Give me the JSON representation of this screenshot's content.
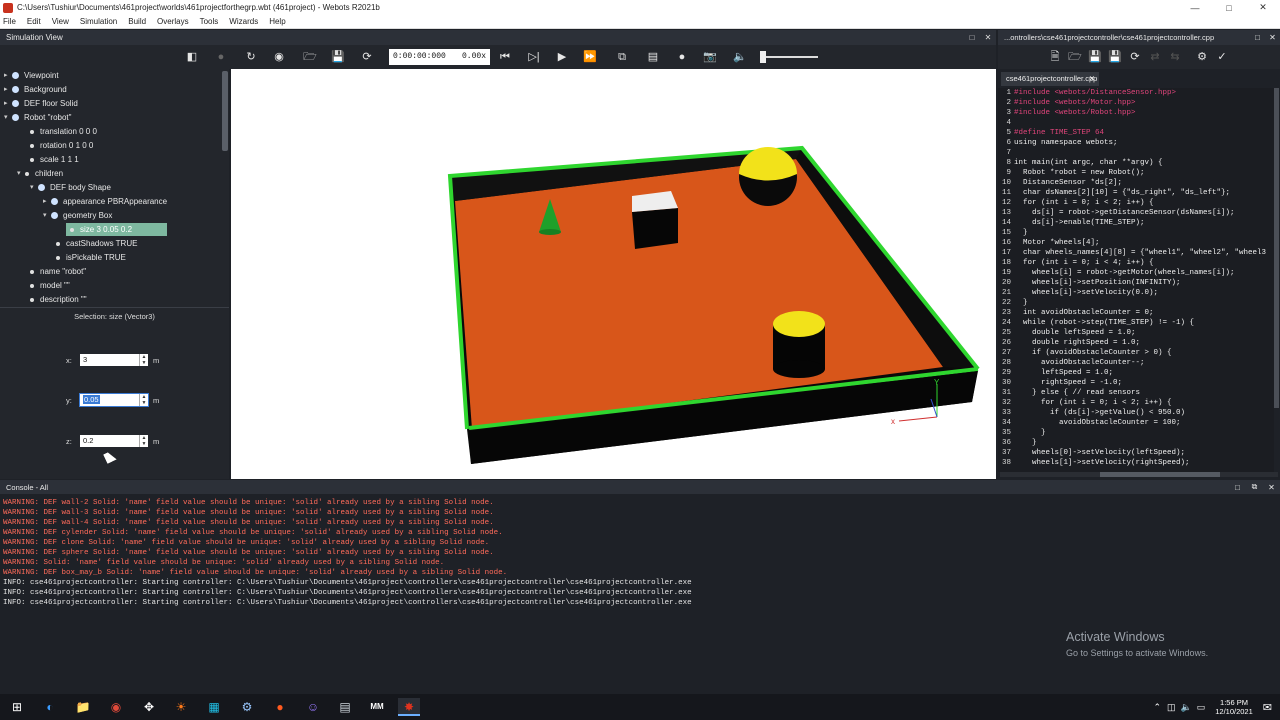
{
  "window": {
    "title": "C:\\Users\\Tushiur\\Documents\\461project\\worlds\\461projectforthegrp.wbt (461project) - Webots R2021b"
  },
  "menu": [
    "File",
    "Edit",
    "View",
    "Simulation",
    "Build",
    "Overlays",
    "Tools",
    "Wizards",
    "Help"
  ],
  "simulation_view": {
    "title": "Simulation View",
    "time": "0:00:00:000",
    "speed": "0.00x"
  },
  "scene_tree": {
    "items": [
      {
        "label": "Viewpoint"
      },
      {
        "label": "Background"
      },
      {
        "label": "DEF floor Solid"
      },
      {
        "label": "Robot \"robot\""
      },
      {
        "label": "translation 0 0 0"
      },
      {
        "label": "rotation 0 1 0 0"
      },
      {
        "label": "scale 1 1 1"
      },
      {
        "label": "children"
      },
      {
        "label": "DEF body Shape"
      },
      {
        "label": "appearance PBRAppearance"
      },
      {
        "label": "geometry Box"
      },
      {
        "label": "size 3 0.05 0.2"
      },
      {
        "label": "castShadows TRUE"
      },
      {
        "label": "isPickable TRUE"
      },
      {
        "label": "name \"robot\""
      },
      {
        "label": "model \"\""
      },
      {
        "label": "description \"\""
      }
    ]
  },
  "field_editor": {
    "selection": "Selection: size (Vector3)",
    "x": {
      "label": "x:",
      "value": "3",
      "unit": "m"
    },
    "y": {
      "label": "y:",
      "value": "0.05",
      "unit": "m"
    },
    "z": {
      "label": "z:",
      "value": "0.2",
      "unit": "m"
    }
  },
  "viewport": {
    "axis_x": "x",
    "axis_y": "Y"
  },
  "editor": {
    "header": "...ontrollers\\cse461projectcontroller\\cse461projectcontroller.cpp",
    "tab": "cse461projectcontroller.cpp",
    "lines": [
      {
        "n": "1",
        "t": "#include <webots/DistanceSensor.hpp>"
      },
      {
        "n": "2",
        "t": "#include <webots/Motor.hpp>"
      },
      {
        "n": "3",
        "t": "#include <webots/Robot.hpp>"
      },
      {
        "n": "4",
        "t": ""
      },
      {
        "n": "5",
        "t": "#define TIME_STEP 64"
      },
      {
        "n": "6",
        "t": "using namespace webots;"
      },
      {
        "n": "7",
        "t": ""
      },
      {
        "n": "8",
        "t": "int main(int argc, char **argv) {"
      },
      {
        "n": "9",
        "t": "  Robot *robot = new Robot();"
      },
      {
        "n": "10",
        "t": "  DistanceSensor *ds[2];"
      },
      {
        "n": "11",
        "t": "  char dsNames[2][10] = {\"ds_right\", \"ds_left\"};"
      },
      {
        "n": "12",
        "t": "  for (int i = 0; i < 2; i++) {"
      },
      {
        "n": "13",
        "t": "    ds[i] = robot->getDistanceSensor(dsNames[i]);"
      },
      {
        "n": "14",
        "t": "    ds[i]->enable(TIME_STEP);"
      },
      {
        "n": "15",
        "t": "  }"
      },
      {
        "n": "16",
        "t": "  Motor *wheels[4];"
      },
      {
        "n": "17",
        "t": "  char wheels_names[4][8] = {\"wheel1\", \"wheel2\", \"wheel3"
      },
      {
        "n": "18",
        "t": "  for (int i = 0; i < 4; i++) {"
      },
      {
        "n": "19",
        "t": "    wheels[i] = robot->getMotor(wheels_names[i]);"
      },
      {
        "n": "20",
        "t": "    wheels[i]->setPosition(INFINITY);"
      },
      {
        "n": "21",
        "t": "    wheels[i]->setVelocity(0.0);"
      },
      {
        "n": "22",
        "t": "  }"
      },
      {
        "n": "23",
        "t": "  int avoidObstacleCounter = 0;"
      },
      {
        "n": "24",
        "t": "  while (robot->step(TIME_STEP) != -1) {"
      },
      {
        "n": "25",
        "t": "    double leftSpeed = 1.0;"
      },
      {
        "n": "26",
        "t": "    double rightSpeed = 1.0;"
      },
      {
        "n": "27",
        "t": "    if (avoidObstacleCounter > 0) {"
      },
      {
        "n": "28",
        "t": "      avoidObstacleCounter--;"
      },
      {
        "n": "29",
        "t": "      leftSpeed = 1.0;"
      },
      {
        "n": "30",
        "t": "      rightSpeed = -1.0;"
      },
      {
        "n": "31",
        "t": "    } else { // read sensors"
      },
      {
        "n": "32",
        "t": "      for (int i = 0; i < 2; i++) {"
      },
      {
        "n": "33",
        "t": "        if (ds[i]->getValue() < 950.0)"
      },
      {
        "n": "34",
        "t": "          avoidObstacleCounter = 100;"
      },
      {
        "n": "35",
        "t": "      }"
      },
      {
        "n": "36",
        "t": "    }"
      },
      {
        "n": "37",
        "t": "    wheels[0]->setVelocity(leftSpeed);"
      },
      {
        "n": "38",
        "t": "    wheels[1]->setVelocity(rightSpeed);"
      }
    ]
  },
  "console": {
    "title": "Console - All",
    "messages": [
      {
        "level": "warn",
        "text": "WARNING: DEF wall-2 Solid: 'name' field value should be unique: 'solid' already used by a sibling Solid node."
      },
      {
        "level": "warn",
        "text": "WARNING: DEF wall-3 Solid: 'name' field value should be unique: 'solid' already used by a sibling Solid node."
      },
      {
        "level": "warn",
        "text": "WARNING: DEF wall-4 Solid: 'name' field value should be unique: 'solid' already used by a sibling Solid node."
      },
      {
        "level": "warn",
        "text": "WARNING: DEF cylender Solid: 'name' field value should be unique: 'solid' already used by a sibling Solid node."
      },
      {
        "level": "warn",
        "text": "WARNING: DEF clone Solid: 'name' field value should be unique: 'solid' already used by a sibling Solid node."
      },
      {
        "level": "warn",
        "text": "WARNING: DEF sphere Solid: 'name' field value should be unique: 'solid' already used by a sibling Solid node."
      },
      {
        "level": "warn",
        "text": "WARNING: Solid: 'name' field value should be unique: 'solid' already used by a sibling Solid node."
      },
      {
        "level": "warn",
        "text": "WARNING: DEF box_may_b Solid: 'name' field value should be unique: 'solid' already used by a sibling Solid node."
      },
      {
        "level": "info",
        "text": "INFO: cse461projectcontroller: Starting controller: C:\\Users\\Tushiur\\Documents\\461project\\controllers\\cse461projectcontroller\\cse461projectcontroller.exe"
      },
      {
        "level": "info",
        "text": "INFO: cse461projectcontroller: Starting controller: C:\\Users\\Tushiur\\Documents\\461project\\controllers\\cse461projectcontroller\\cse461projectcontroller.exe"
      },
      {
        "level": "info",
        "text": "INFO: cse461projectcontroller: Starting controller: C:\\Users\\Tushiur\\Documents\\461project\\controllers\\cse461projectcontroller\\cse461projectcontroller.exe"
      }
    ]
  },
  "watermark": {
    "line1": "Activate Windows",
    "line2": "Go to Settings to activate Windows."
  },
  "taskbar": {
    "time": "1:56 PM",
    "date": "12/10/2021",
    "mm_label": "MM"
  },
  "colors": {
    "floor": "#d8561a",
    "wall_top": "#2fd62f",
    "wall": "#0a0a0a",
    "sphere": "#f2e21a",
    "cone": "#1fa02a",
    "selection": "#7eb8a0",
    "warning": "#ff6b5a"
  }
}
